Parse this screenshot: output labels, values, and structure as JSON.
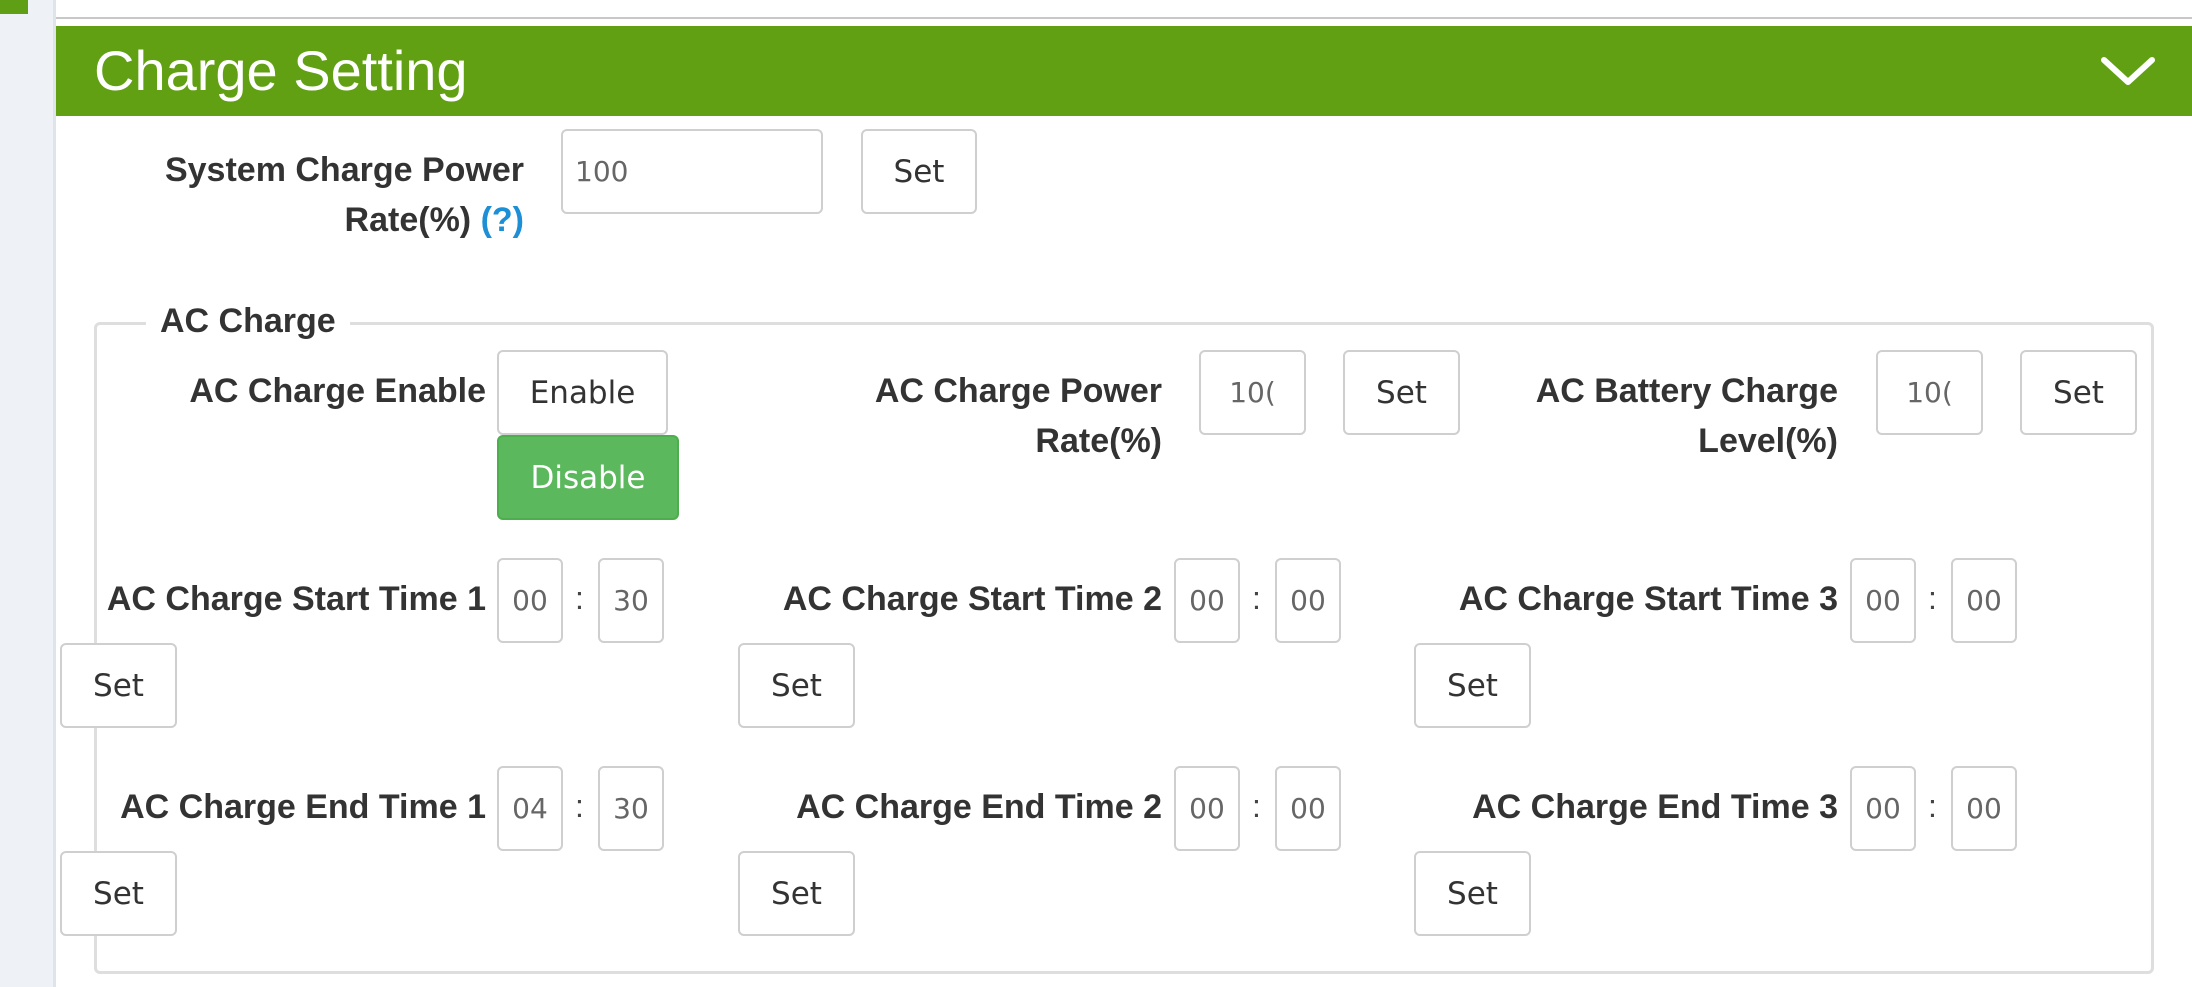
{
  "header": {
    "title": "Charge Setting",
    "toggle_icon": "chevron-down-icon"
  },
  "system_charge": {
    "label_line1": "System Charge Power",
    "label_line2": "Rate(%)",
    "help": "(?)",
    "value": "100",
    "set_label": "Set"
  },
  "ac_charge": {
    "legend": "AC Charge",
    "enable": {
      "label": "AC Charge Enable",
      "enable_label": "Enable",
      "disable_label": "Disable",
      "selected": "Disable"
    },
    "power_rate": {
      "label_line1": "AC Charge Power",
      "label_line2": "Rate(%)",
      "value": "10(",
      "set_label": "Set"
    },
    "battery_level": {
      "label_line1": "AC Battery Charge",
      "label_line2": "Level(%)",
      "value": "10(",
      "set_label": "Set"
    },
    "start_times": [
      {
        "label": "AC Charge Start Time 1",
        "hour": "00",
        "minute": "30",
        "separator": ":",
        "set_label": "Set"
      },
      {
        "label": "AC Charge Start Time 2",
        "hour": "00",
        "minute": "00",
        "separator": ":",
        "set_label": "Set"
      },
      {
        "label": "AC Charge Start Time 3",
        "hour": "00",
        "minute": "00",
        "separator": ":",
        "set_label": "Set"
      }
    ],
    "end_times": [
      {
        "label": "AC Charge End Time 1",
        "hour": "04",
        "minute": "30",
        "separator": ":",
        "set_label": "Set"
      },
      {
        "label": "AC Charge End Time 2",
        "hour": "00",
        "minute": "00",
        "separator": ":",
        "set_label": "Set"
      },
      {
        "label": "AC Charge End Time 3",
        "hour": "00",
        "minute": "00",
        "separator": ":",
        "set_label": "Set"
      }
    ]
  },
  "colors": {
    "header_bg": "#62a013",
    "selected_button": "#5cb85c",
    "help_link": "#1d8fd6"
  }
}
